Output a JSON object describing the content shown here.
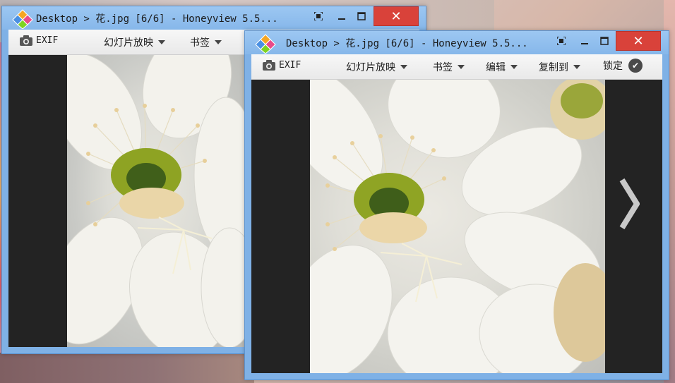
{
  "back_window": {
    "title": "Desktop > 花.jpg [6/6] - Honeyview 5.5...",
    "toolbar": {
      "exif": "EXIF",
      "slideshow": "幻灯片放映",
      "bookmark": "书签"
    }
  },
  "front_window": {
    "title": "Desktop > 花.jpg [6/6] - Honeyview 5.5...",
    "toolbar": {
      "exif": "EXIF",
      "slideshow": "幻灯片放映",
      "bookmark": "书签",
      "edit": "编辑",
      "copy_to": "复制到",
      "lock": "锁定"
    }
  },
  "colors": {
    "titlebar": "#86b7ea",
    "close": "#d9423a",
    "viewer_bg": "#232323"
  },
  "icons": [
    "honeyview-app-icon",
    "camera-icon",
    "caret-down-icon",
    "checkmark-icon",
    "next-arrow-icon"
  ]
}
